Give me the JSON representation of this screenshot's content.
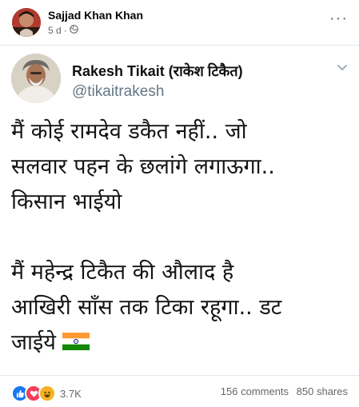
{
  "post": {
    "author": "Sajjad Khan Khan",
    "time": "5 d",
    "separator": "·",
    "privacy_icon": "globe-icon",
    "more_label": "···"
  },
  "tweet": {
    "name": "Rakesh Tikait (राकेश टिकैत)",
    "handle": "@tikaitrakesh",
    "lines": [
      "मैं कोई रामदेव डकैत नहीं.. जो",
      "सलवार पहन के छलांगे लगाऊगा..",
      "किसान भाईयो",
      "मैं महेन्द्र टिकैत की औलाद है",
      "आखिरी साँस तक टिका रहूगा.. डट",
      "जाईये"
    ],
    "flag_icon": "indian-flag-icon"
  },
  "footer": {
    "reaction_icons": [
      "like-icon",
      "love-icon",
      "haha-icon"
    ],
    "reaction_count": "3.7K",
    "comments": "156 comments",
    "shares": "850 shares"
  },
  "colors": {
    "like": "#1877f2",
    "love": "#f33e58",
    "haha": "#f7b125",
    "secondary_text": "#65676b",
    "handle": "#657786"
  }
}
